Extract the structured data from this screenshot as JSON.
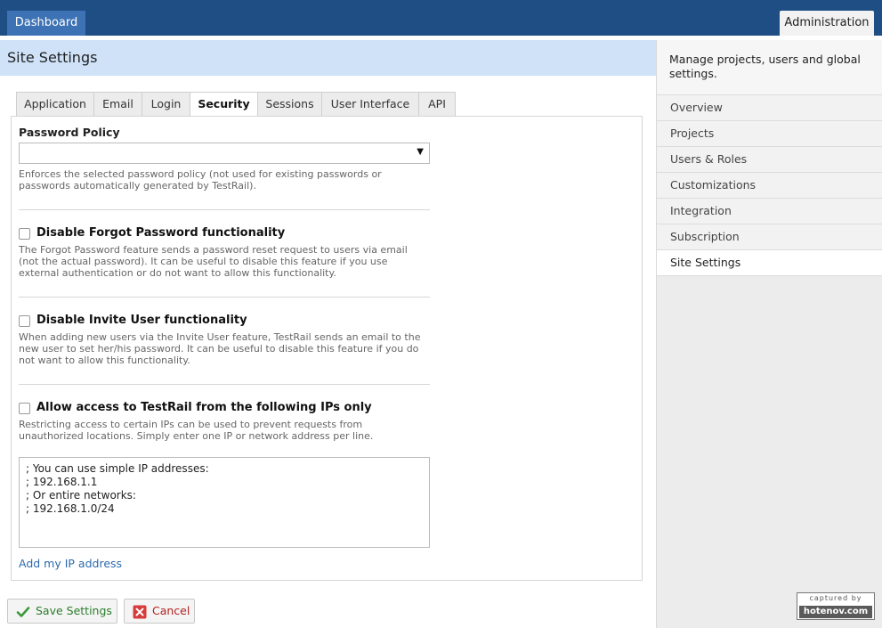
{
  "topnav": {
    "dashboard_label": "Dashboard",
    "admin_label": "Administration"
  },
  "page": {
    "title": "Site Settings"
  },
  "sidebar": {
    "description": "Manage projects, users and global settings.",
    "items": [
      {
        "label": "Overview",
        "active": false
      },
      {
        "label": "Projects",
        "active": false
      },
      {
        "label": "Users & Roles",
        "active": false
      },
      {
        "label": "Customizations",
        "active": false
      },
      {
        "label": "Integration",
        "active": false
      },
      {
        "label": "Subscription",
        "active": false
      },
      {
        "label": "Site Settings",
        "active": true
      }
    ]
  },
  "tabs": [
    {
      "label": "Application",
      "active": false
    },
    {
      "label": "Email",
      "active": false
    },
    {
      "label": "Login",
      "active": false
    },
    {
      "label": "Security",
      "active": true
    },
    {
      "label": "Sessions",
      "active": false
    },
    {
      "label": "User Interface",
      "active": false
    },
    {
      "label": "API",
      "active": false
    }
  ],
  "security": {
    "password_policy_label": "Password Policy",
    "password_policy_value": "",
    "password_policy_help": "Enforces the selected password policy (not used for existing passwords or passwords automatically generated by TestRail).",
    "forgot_password": {
      "label": "Disable Forgot Password functionality",
      "checked": false,
      "help": "The Forgot Password feature sends a password reset request to users via email (not the actual password). It can be useful to disable this feature if you use external authentication or do not want to allow this functionality."
    },
    "invite_user": {
      "label": "Disable Invite User functionality",
      "checked": false,
      "help": "When adding new users via the Invite User feature, TestRail sends an email to the new user to set her/his password. It can be useful to disable this feature if you do not want to allow this functionality."
    },
    "ip_access": {
      "label": "Allow access to TestRail from the following IPs only",
      "checked": false,
      "help": "Restricting access to certain IPs can be used to prevent requests from unauthorized locations. Simply enter one IP or network address per line.",
      "textarea_lines": [
        "; You can use simple IP addresses:",
        "; 192.168.1.1",
        "; Or entire networks:",
        "; 192.168.1.0/24"
      ],
      "add_ip_link": "Add my IP address"
    }
  },
  "actions": {
    "save_label": "Save Settings",
    "cancel_label": "Cancel"
  },
  "watermark": {
    "top": "captured by",
    "bottom": "hotenov.com"
  },
  "colors": {
    "topbar": "#1f4e85",
    "dashboard_tab": "#3d72b4",
    "header_band": "#cfe2f8",
    "link": "#2d6aad",
    "save_green": "#2a7d2a",
    "cancel_red": "#b32020"
  }
}
